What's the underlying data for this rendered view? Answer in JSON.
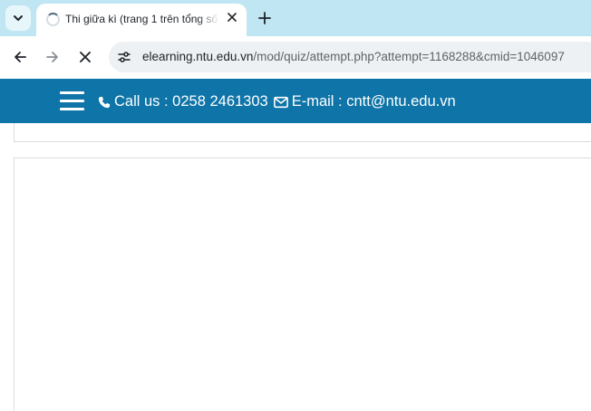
{
  "browser": {
    "tab": {
      "title": "Thi giữa kì (trang 1 trên tổng số"
    },
    "address_bar": {
      "url_host": "elearning.ntu.edu.vn",
      "url_path": "/mod/quiz/attempt.php?attempt=1168288&cmid=1046097"
    },
    "icons": {
      "tab_search": "chevron-down-icon",
      "tab_loading": "loading-spinner-icon",
      "tab_close": "close-icon",
      "new_tab": "plus-icon",
      "back": "arrow-left-icon",
      "forward": "arrow-right-icon",
      "stop": "close-icon",
      "site_info": "tune-icon"
    }
  },
  "site_header": {
    "phone_label": "Call us : 0258 2461303",
    "email_label": "E-mail : cntt@ntu.edu.vn",
    "icons": {
      "menu": "hamburger-menu-icon",
      "phone": "phone-icon",
      "email": "envelope-icon"
    }
  },
  "colors": {
    "tabstrip_bg": "#bfe6f2",
    "header_bg": "#0f74a8",
    "omnibox_bg": "#eef1f3"
  }
}
